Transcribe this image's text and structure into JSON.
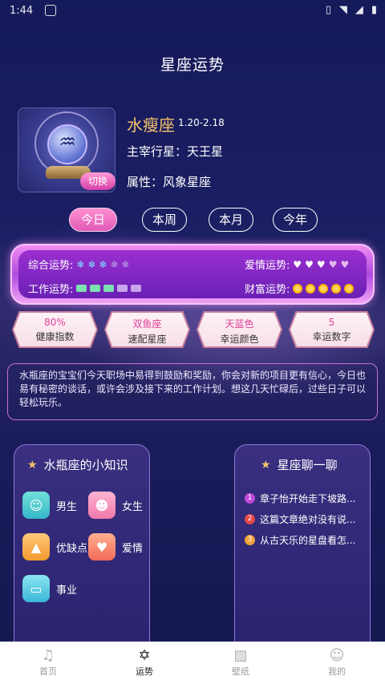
{
  "status_bar": {
    "time": "1:44"
  },
  "page": {
    "title": "星座运势"
  },
  "sign": {
    "name": "水瘦座",
    "dates": "1.20-2.18",
    "ruling_planet": "主宰行星：天王星",
    "attribute": "属性：风象星座",
    "switch_label": "切换"
  },
  "tabs": [
    {
      "label": "今日",
      "active": true
    },
    {
      "label": "本周",
      "active": false
    },
    {
      "label": "本月",
      "active": false
    },
    {
      "label": "今年",
      "active": false
    }
  ],
  "luck": {
    "overall": {
      "label": "综合运势:",
      "score": 3,
      "max": 5
    },
    "love": {
      "label": "爱情运势:",
      "score": 3,
      "max": 5
    },
    "work": {
      "label": "工作运势:",
      "score": 3,
      "max": 5
    },
    "wealth": {
      "label": "财富运势:",
      "score": 5,
      "max": 5
    }
  },
  "stats": [
    {
      "value": "80%",
      "label": "健康指数"
    },
    {
      "value": "双鱼座",
      "label": "速配星座"
    },
    {
      "value": "天蓝色",
      "label": "幸运颜色"
    },
    {
      "value": "5",
      "label": "幸运数字"
    }
  ],
  "description": "水瓶座的宝宝们今天职场中易得到鼓励和奖励，你会对新的项目更有信心，今日也易有秘密的谈话，或许会涉及接下来的工作计划。想这几天忙碌后，过些日子可以轻松玩乐。",
  "knowledge": {
    "title": "水瓶座的小知识",
    "items": [
      {
        "label": "男生",
        "icon": "male-icon"
      },
      {
        "label": "女生",
        "icon": "female-icon"
      },
      {
        "label": "优缺点",
        "icon": "graduation-cap-icon"
      },
      {
        "label": "爱情",
        "icon": "heart-icon"
      },
      {
        "label": "事业",
        "icon": "monitor-icon"
      }
    ]
  },
  "chat": {
    "title": "星座聊一聊",
    "items": [
      {
        "num": "1",
        "text": "章子怡开始走下坡路...",
        "color": "#c04bd8"
      },
      {
        "num": "2",
        "text": "这篇文章绝对没有说...",
        "color": "#e24848"
      },
      {
        "num": "3",
        "text": "从古天乐的星盘看怎...",
        "color": "#f0a23a"
      }
    ]
  },
  "nav": [
    {
      "label": "首页",
      "icon": "music-note-icon",
      "active": false
    },
    {
      "label": "运势",
      "icon": "star-of-david-icon",
      "active": true
    },
    {
      "label": "壁纸",
      "icon": "image-icon",
      "active": false
    },
    {
      "label": "我的",
      "icon": "face-icon",
      "active": false
    }
  ]
}
